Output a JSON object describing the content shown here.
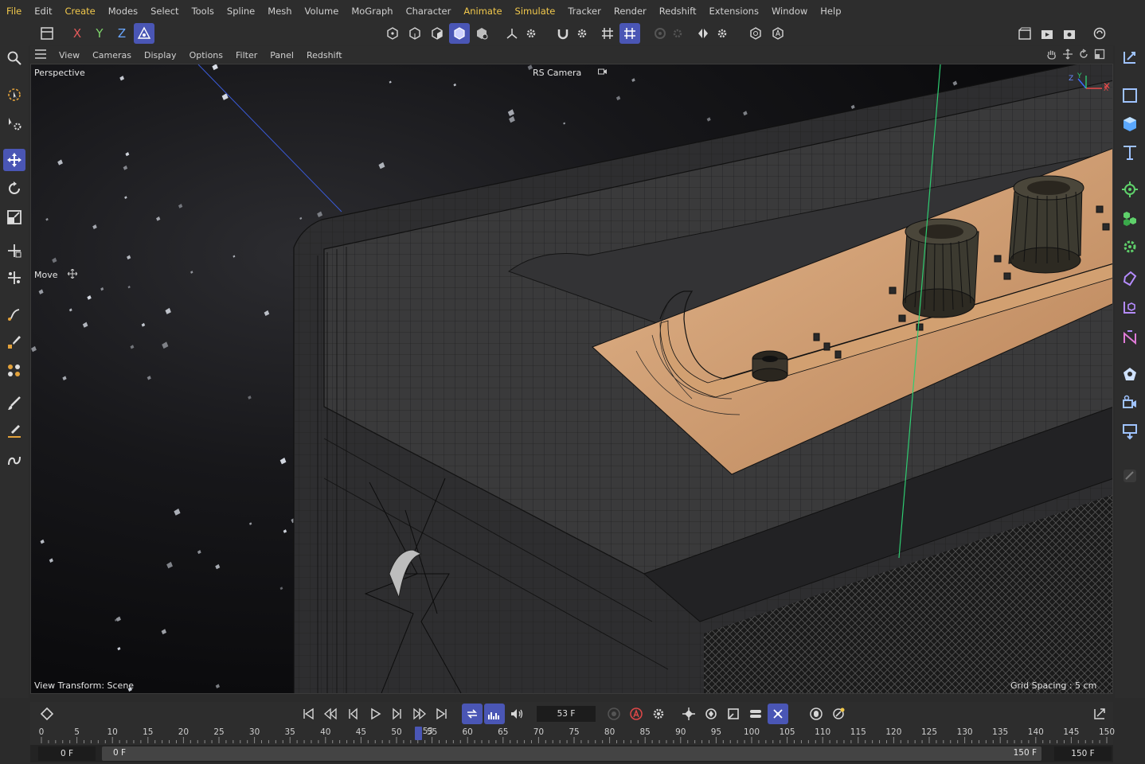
{
  "menu": [
    "File",
    "Edit",
    "Create",
    "Modes",
    "Select",
    "Tools",
    "Spline",
    "Mesh",
    "Volume",
    "MoGraph",
    "Character",
    "Animate",
    "Simulate",
    "Tracker",
    "Render",
    "Redshift",
    "Extensions",
    "Window",
    "Help"
  ],
  "menu_highlighted": [
    "File",
    "Create",
    "Animate",
    "Simulate"
  ],
  "toolbar": {
    "axis_x": "X",
    "axis_y": "Y",
    "axis_z": "Z"
  },
  "viewport_menu": [
    "View",
    "Cameras",
    "Display",
    "Options",
    "Filter",
    "Panel",
    "Redshift"
  ],
  "viewport": {
    "name": "Perspective",
    "camera": "RS Camera",
    "tool_hint": "Move",
    "view_transform": "View Transform: Scene",
    "grid_spacing": "Grid Spacing : 5 cm"
  },
  "timeline": {
    "current_frame": "53 F",
    "current_frame_marker": "53",
    "ticks": [
      "0",
      "5",
      "10",
      "15",
      "20",
      "25",
      "30",
      "35",
      "40",
      "45",
      "50",
      "55",
      "60",
      "65",
      "70",
      "75",
      "80",
      "85",
      "90",
      "95",
      "100",
      "105",
      "110",
      "115",
      "120",
      "125",
      "130",
      "135",
      "140",
      "145",
      "150"
    ],
    "min_field": "0 F",
    "start_field": "0 F",
    "end_field": "150 F",
    "max_field": "150 F"
  },
  "colors": {
    "accent": "#4a56b5",
    "highlight_text": "#f2c94c",
    "copper_panel": "#c9976a",
    "axis_green": "#2ecc71"
  },
  "icons": {
    "left_palette": [
      "search-icon",
      "live-selection-icon",
      "settings-tool-icon",
      "move-icon",
      "rotate-icon",
      "scale-icon",
      "transform-icon",
      "snap-icon",
      "pen-icon",
      "point-icon",
      "polygon-icon",
      "brush-icon",
      "edge-icon",
      "spline-icon"
    ],
    "right_palette": [
      "null-object-icon",
      "rectangle-icon",
      "cube-icon",
      "text-icon",
      "mograph-cloner-icon",
      "effector-icon",
      "generator-icon",
      "deformer-icon",
      "field-icon",
      "fracture-icon",
      "environment-icon",
      "camera-icon",
      "light-icon",
      "tag-icon"
    ]
  }
}
